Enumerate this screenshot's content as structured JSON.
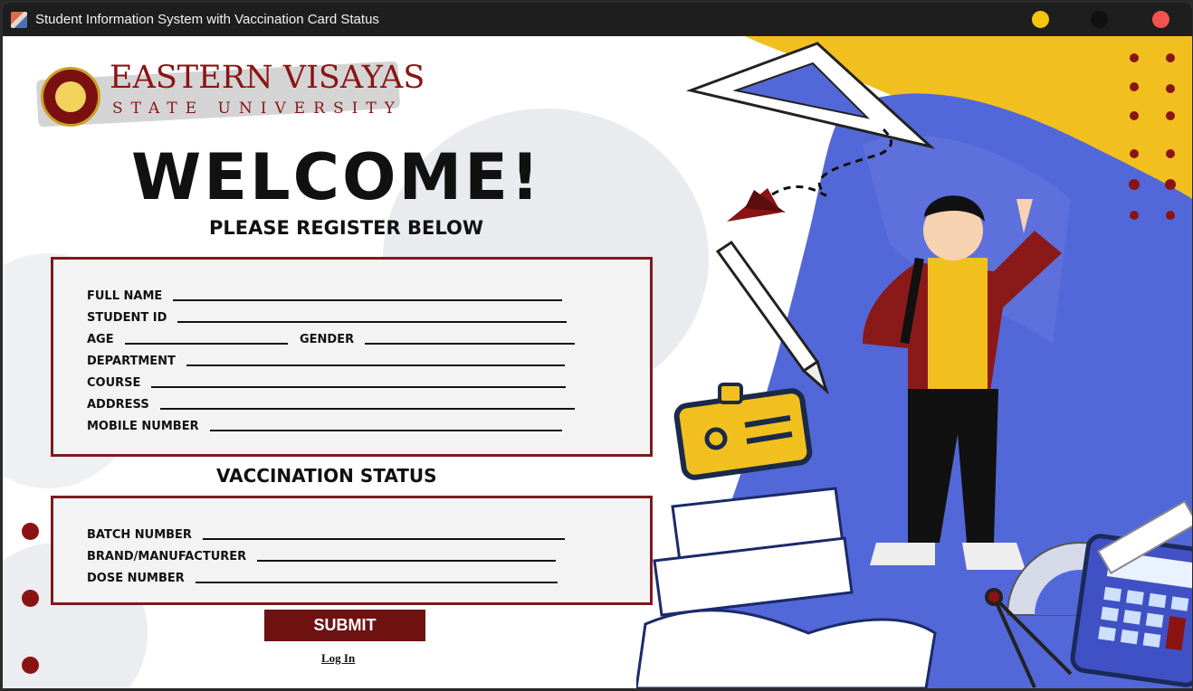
{
  "window": {
    "title": "Student Information System with Vaccination Card Status"
  },
  "logo": {
    "line1": "EASTERN VISAYAS",
    "line2": "STATE UNIVERSITY"
  },
  "header": {
    "welcome": "WELCOME!",
    "subtitle": "PLEASE REGISTER BELOW"
  },
  "student_form": {
    "full_name_label": "FULL NAME",
    "student_id_label": "STUDENT ID",
    "age_label": "AGE",
    "gender_label": "GENDER",
    "department_label": "DEPARTMENT",
    "course_label": "COURSE",
    "address_label": "ADDRESS",
    "mobile_label": "MOBILE NUMBER"
  },
  "vaccination": {
    "title": "VACCINATION STATUS",
    "batch_label": "BATCH NUMBER",
    "brand_label": "BRAND/MANUFACTURER",
    "dose_label": "DOSE NUMBER"
  },
  "actions": {
    "submit_label": "SUBMIT",
    "login_label": "Log In"
  },
  "colors": {
    "accent": "#6e1111",
    "blue": "#5368d8",
    "yellow": "#f2c01e"
  },
  "icons": {
    "app": "app-icon",
    "minimize": "yellow-circle",
    "maximize": "black-circle",
    "close": "red-circle"
  }
}
